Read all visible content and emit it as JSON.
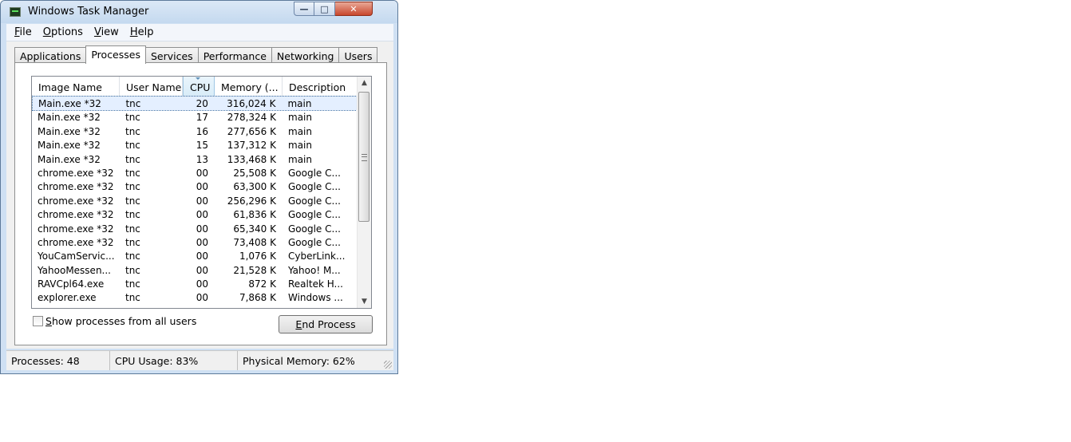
{
  "window": {
    "title": "Windows Task Manager",
    "caption_buttons": {
      "minimize": "—",
      "maximize": "□",
      "close": "✕"
    }
  },
  "menu": [
    {
      "underline": "F",
      "rest": "ile"
    },
    {
      "underline": "O",
      "rest": "ptions"
    },
    {
      "underline": "V",
      "rest": "iew"
    },
    {
      "underline": "H",
      "rest": "elp"
    }
  ],
  "tabs": [
    "Applications",
    "Processes",
    "Services",
    "Performance",
    "Networking",
    "Users"
  ],
  "active_tab": "Processes",
  "columns": [
    "Image Name",
    "User Name",
    "CPU",
    "Memory (...",
    "Description"
  ],
  "sorted_column": "CPU",
  "processes": [
    {
      "image": "Main.exe *32",
      "user": "tnc",
      "cpu": "20",
      "memory": "316,024 K",
      "desc": "main"
    },
    {
      "image": "Main.exe *32",
      "user": "tnc",
      "cpu": "17",
      "memory": "278,324 K",
      "desc": "main"
    },
    {
      "image": "Main.exe *32",
      "user": "tnc",
      "cpu": "16",
      "memory": "277,656 K",
      "desc": "main"
    },
    {
      "image": "Main.exe *32",
      "user": "tnc",
      "cpu": "15",
      "memory": "137,312 K",
      "desc": "main"
    },
    {
      "image": "Main.exe *32",
      "user": "tnc",
      "cpu": "13",
      "memory": "133,468 K",
      "desc": "main"
    },
    {
      "image": "chrome.exe *32",
      "user": "tnc",
      "cpu": "00",
      "memory": "25,508 K",
      "desc": "Google C..."
    },
    {
      "image": "chrome.exe *32",
      "user": "tnc",
      "cpu": "00",
      "memory": "63,300 K",
      "desc": "Google C..."
    },
    {
      "image": "chrome.exe *32",
      "user": "tnc",
      "cpu": "00",
      "memory": "256,296 K",
      "desc": "Google C..."
    },
    {
      "image": "chrome.exe *32",
      "user": "tnc",
      "cpu": "00",
      "memory": "61,836 K",
      "desc": "Google C..."
    },
    {
      "image": "chrome.exe *32",
      "user": "tnc",
      "cpu": "00",
      "memory": "65,340 K",
      "desc": "Google C..."
    },
    {
      "image": "chrome.exe *32",
      "user": "tnc",
      "cpu": "00",
      "memory": "73,408 K",
      "desc": "Google C..."
    },
    {
      "image": "YouCamServic...",
      "user": "tnc",
      "cpu": "00",
      "memory": "1,076 K",
      "desc": "CyberLink..."
    },
    {
      "image": "YahooMessen...",
      "user": "tnc",
      "cpu": "00",
      "memory": "21,528 K",
      "desc": "Yahoo! M..."
    },
    {
      "image": "RAVCpl64.exe",
      "user": "tnc",
      "cpu": "00",
      "memory": "872 K",
      "desc": "Realtek H..."
    },
    {
      "image": "explorer.exe",
      "user": "tnc",
      "cpu": "00",
      "memory": "7,868 K",
      "desc": "Windows ..."
    }
  ],
  "selected_row": 0,
  "show_all_users": {
    "underline": "S",
    "rest": "how processes from all users",
    "checked": false
  },
  "end_process": {
    "underline": "E",
    "rest": "nd Process"
  },
  "status": {
    "processes": "Processes: 48",
    "cpu": "CPU Usage: 83%",
    "memory": "Physical Memory: 62%"
  },
  "icons": {
    "app": "task-manager-icon",
    "scroll_up": "▲",
    "scroll_down": "▼"
  }
}
